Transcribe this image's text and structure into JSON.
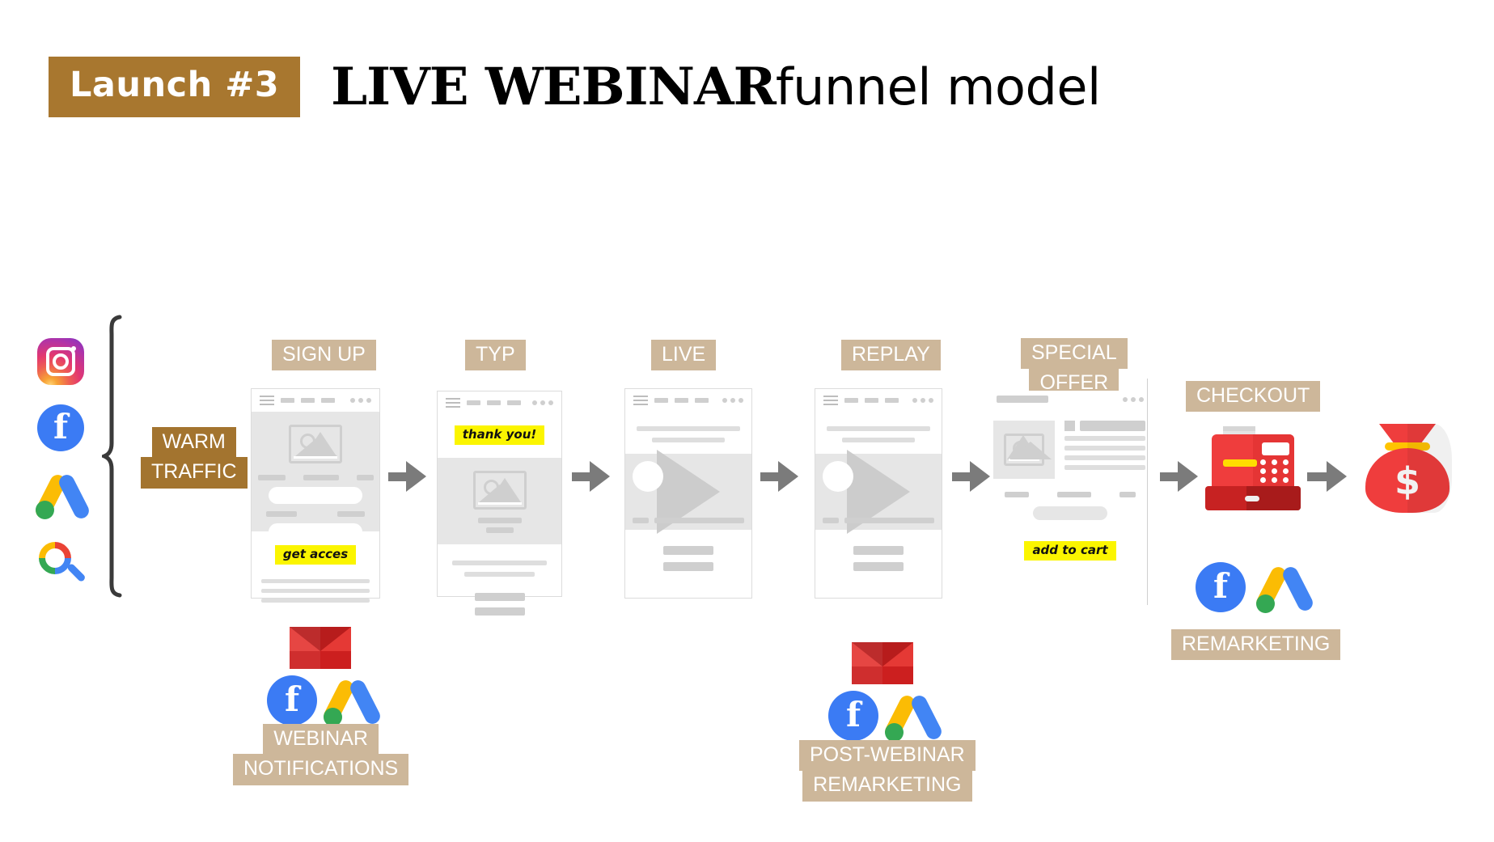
{
  "header": {
    "badge": "Launch #3",
    "title_strong": "LIVE WEBINAR",
    "title_light": "funnel model",
    "badge_color": "#a8772f"
  },
  "traffic": {
    "label_line1": "WARM",
    "label_line2": "TRAFFIC",
    "icons": [
      "instagram-icon",
      "facebook-icon",
      "google-ads-icon",
      "google-search-icon"
    ]
  },
  "steps": [
    {
      "id": "sign-up",
      "label": "SIGN UP",
      "highlight": "get acces",
      "type": "landing"
    },
    {
      "id": "typ",
      "label": "TYP",
      "highlight": "thank you!",
      "type": "thankyou"
    },
    {
      "id": "live",
      "label": "LIVE",
      "type": "video"
    },
    {
      "id": "replay",
      "label": "REPLAY",
      "type": "video"
    },
    {
      "id": "special-offer",
      "label_line1": "SPECIAL",
      "label_line2": "OFFER",
      "highlight": "add to cart",
      "type": "product"
    },
    {
      "id": "checkout",
      "label": "CHECKOUT",
      "type": "register"
    },
    {
      "id": "revenue",
      "type": "moneybag",
      "symbol": "$"
    }
  ],
  "annotations": {
    "webinar_notifications_line1": "WEBINAR",
    "webinar_notifications_line2": "NOTIFICATIONS",
    "post_webinar_line1": "POST-WEBINAR",
    "post_webinar_line2": "REMARKETING",
    "remarketing": "REMARKETING"
  },
  "colors": {
    "tag_light": "#cdb79a",
    "tag_dark": "#a3742f",
    "highlight_yellow": "#fbf500",
    "arrow_grey": "#7b7b7b",
    "accent_red": "#ef3d3d"
  }
}
